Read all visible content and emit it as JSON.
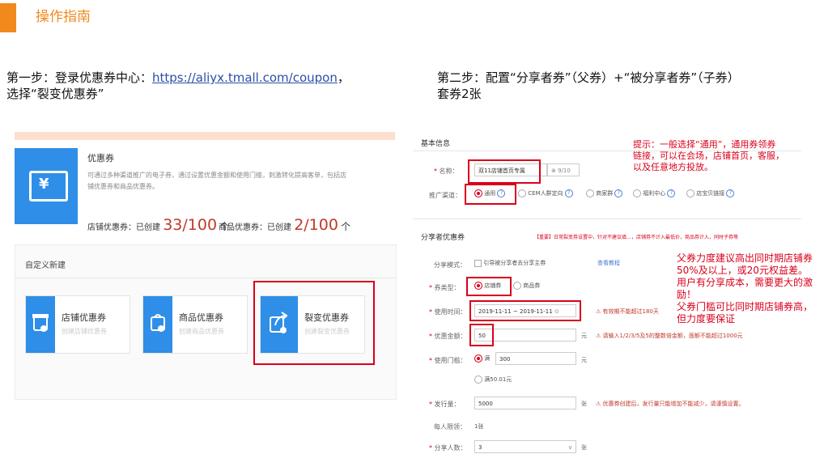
{
  "header": {
    "title": "操作指南",
    "accent": "#f08a1d"
  },
  "step1": {
    "line1_prefix": "第一步：登录优惠券中心：",
    "link": "https://aliyx.tmall.com/coupon",
    "line1_suffix": "，",
    "line2": "选择“裂变优惠券”"
  },
  "step2": {
    "line1": "第二步：配置“分享者券”（父券）+“被分享者券”（子券）",
    "line2": "套券2张"
  },
  "left_panel": {
    "coupon_title": "优惠券",
    "coupon_desc1": "可通过多种渠道推广的电子券，通过设置优惠金额和使用门槛，刺激转化提高客单，包括店",
    "coupon_desc2": "铺优惠券和商品优惠券。",
    "shop_stat_label": "店铺优惠券：已创建",
    "shop_stat_num": "33/100",
    "shop_stat_unit": "个",
    "item_stat_label": "商品优惠券：已创建",
    "item_stat_num": "2/100",
    "item_stat_unit": "个",
    "custom_label": "自定义新建",
    "cards": [
      {
        "title": "店铺优惠券",
        "sub": "创建店铺优惠券"
      },
      {
        "title": "商品优惠券",
        "sub": "创建商品优惠券"
      },
      {
        "title": "裂变优惠券",
        "sub": "创建裂变优惠券"
      }
    ]
  },
  "right_panel": {
    "basic_info": "基本信息",
    "name_label": "名称",
    "name_value": "双11店铺首页专属",
    "name_count": "9/10",
    "channel_label": "推广渠道",
    "channel_options": [
      "通用",
      "CEM人群定向",
      "商家群",
      "福利中心",
      "店宝贝链接"
    ],
    "tip_lines": [
      "提示：一般选择“通用”，通用券领券",
      "链接，可以在会场，店铺首页，客服，",
      "以及任意地方投放。"
    ],
    "sharer_title": "分享者优惠券",
    "sharer_warning": "【重要】日常裂变券设置中，针对不建议填…，店铺券不计入最低价，商品券计入，同时子券等",
    "share_mode_label": "分享模式",
    "share_mode_opt": "引导被分享者去分享主券",
    "share_mode_link": "查看教程",
    "coupon_type_label": "券类型",
    "coupon_type_opts": [
      "店铺券",
      "商品券"
    ],
    "use_time_label": "使用时间",
    "date_start": "2019-11-11",
    "date_end": "2019-11-11",
    "use_time_warn": "有效期不能超过180天",
    "amount_label": "优惠金额",
    "amount_value": "50",
    "amount_unit": "元",
    "amount_warn": "请输入1/2/3/5及5的整数倍金额，面额不能超过1000元",
    "threshold_label": "使用门槛",
    "threshold_opt1": "满",
    "threshold_value": "300",
    "threshold_unit": "元",
    "threshold_opt2": "满50.01元",
    "issue_label": "发行量",
    "issue_value": "5000",
    "issue_unit": "张",
    "issue_warn": "优惠券创建后，发行量只能增加不能减少，请谨慎设置。",
    "per_person_label": "每人限领",
    "per_person_value": "1张",
    "share_people_label": "分享人数",
    "share_people_value": "3",
    "share_people_unit": "张",
    "note_lines": [
      "父券力度建议高出同时期店铺券",
      "50%及以上，或20元权益差。",
      "用户有分享成本，需要更大的激",
      "励！",
      "父券门槛可比同时期店铺券高，",
      "但力度要保证"
    ]
  }
}
